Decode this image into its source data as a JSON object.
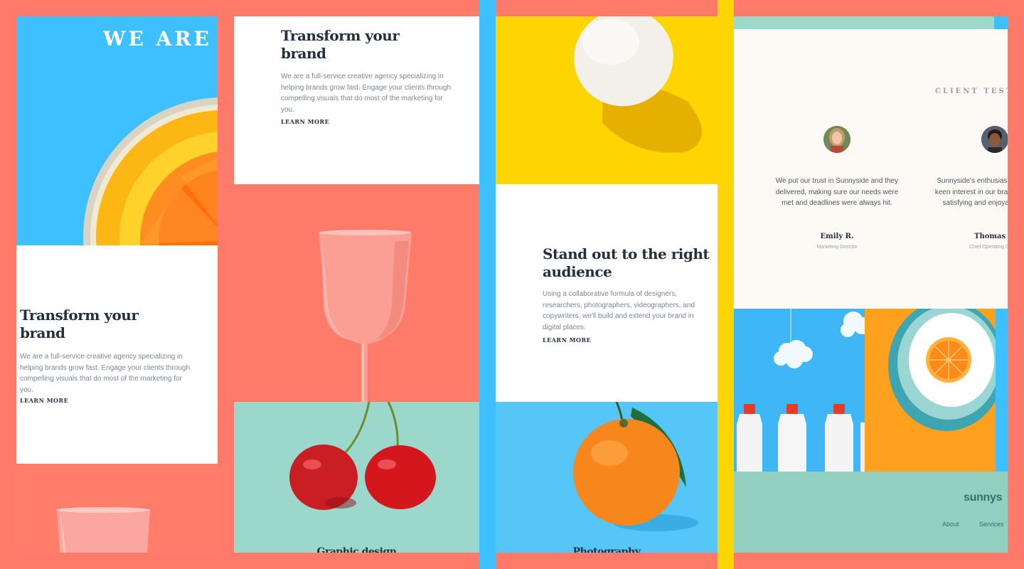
{
  "hero": {
    "headline": "WE ARE C"
  },
  "panel1": {
    "title": "Transform your brand",
    "body": "We are a full-service creative agency specializing in helping brands grow fast. Engage your clients through compelling visuals that do most of the marketing for you.",
    "cta": "LEARN MORE"
  },
  "panel2": {
    "title": "Transform your brand",
    "body": "We are a full-service creative agency specializing in helping brands grow fast. Engage your clients through compelling visuals that do most of the marketing for you.",
    "cta": "LEARN MORE",
    "caption": "Graphic design"
  },
  "panel3": {
    "title": "Stand out to the right audience",
    "body": "Using a collaborative formula of designers, researchers, photographers, videographers, and copywriters, we'll build and extend your brand in digital places.",
    "cta": "LEARN MORE",
    "caption": "Photography"
  },
  "testimonials": {
    "heading": "CLIENT TESTI",
    "items": [
      {
        "quote": "We put our trust in Sunnyside and they delivered, making sure our needs were met and deadlines were always hit.",
        "name": "Emily R.",
        "role": "Marketing Director"
      },
      {
        "quote": "Sunnyside's enthusiasm c keen interest in our brand's satisfying and enjoyab",
        "name": "Thomas S",
        "role": "Chief Operating O"
      }
    ]
  },
  "footer": {
    "logo": "sunnys",
    "links": [
      "About",
      "Services"
    ]
  },
  "colors": {
    "background": "#ff7a68",
    "sky_blue": "#3ebfff",
    "yellow": "#ffd500",
    "mint": "#96d4c5",
    "dark_navy": "#23303e"
  }
}
